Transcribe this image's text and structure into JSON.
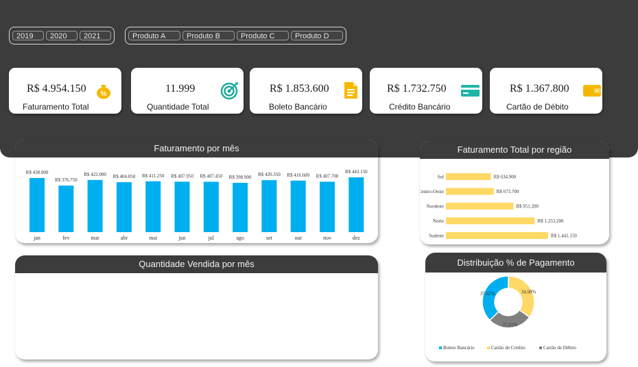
{
  "filters": {
    "years": [
      "2019",
      "2020",
      "2021"
    ],
    "products": [
      "Produto A",
      "Produto B",
      "Produto C",
      "Produto D"
    ]
  },
  "kpis": [
    {
      "value": "R$ 4.954.150",
      "label": "Faturamento Total",
      "icon": "money-bag-icon",
      "color": "#f5b800"
    },
    {
      "value": "11.999",
      "label": "Quantidade Total",
      "icon": "target-icon",
      "color": "#1fa99a"
    },
    {
      "value": "R$ 1.853.600",
      "label": "Boleto Bancário",
      "icon": "document-icon",
      "color": "#f5b800"
    },
    {
      "value": "R$ 1.732.750",
      "label": "Crédito Bancário",
      "icon": "credit-card-icon",
      "color": "#1fb4a6"
    },
    {
      "value": "R$ 1.367.800",
      "label": "Cartão de Débito",
      "icon": "wallet-icon",
      "color": "#f5b800"
    }
  ],
  "panels": {
    "monthly_title": "Faturamento por mês",
    "region_title": "Faturamento Total por região",
    "quantity_title": "Quantidade Vendida por mês",
    "payment_title": "Distribuição % de Pagamento"
  },
  "colors": {
    "bar": "#00aff0",
    "region_bar": "#ffd966",
    "cartao_credito": "#ffd966",
    "cartao_debito": "#808080",
    "header": "#3c3c3c"
  },
  "chart_data": [
    {
      "type": "bar",
      "title": "Faturamento por mês",
      "categories": [
        "jan",
        "fev",
        "mar",
        "abr",
        "mai",
        "jun",
        "jul",
        "ago",
        "set",
        "out",
        "nov",
        "dez"
      ],
      "values": [
        438000,
        376750,
        422000,
        404050,
        411250,
        407950,
        407450,
        398900,
        420350,
        416600,
        407700,
        443150
      ],
      "labels": [
        "R$ 438.000",
        "R$ 376.750",
        "R$ 422.000",
        "R$ 404.050",
        "R$ 411.250",
        "R$ 407.950",
        "R$ 407.450",
        "R$ 398.900",
        "R$ 420.350",
        "R$ 416.600",
        "R$ 407.700",
        "R$ 443.150"
      ]
    },
    {
      "type": "bar",
      "orientation": "horizontal",
      "title": "Faturamento Total por região",
      "categories": [
        "Sul",
        "Centro-Oeste",
        "Nordeste",
        "Norte",
        "Sudeste"
      ],
      "values": [
        634900,
        673700,
        951200,
        1253200,
        1441150
      ],
      "labels": [
        "R$ 634.900",
        "R$ 673.700",
        "R$ 951.200",
        "R$ 1.253.200",
        "R$ 1.441.150"
      ]
    },
    {
      "type": "pie",
      "title": "Distribuição % de Pagamento",
      "categories": [
        "Boleto Bancário",
        "Cartão de Crédito",
        "Cartão de Débito"
      ],
      "values": [
        37.42,
        34.98,
        27.61
      ],
      "labels": [
        "37,42%",
        "34,98%",
        "27,61%"
      ],
      "colors": [
        "#00aff0",
        "#ffd966",
        "#808080"
      ],
      "legend": "bottom"
    }
  ]
}
